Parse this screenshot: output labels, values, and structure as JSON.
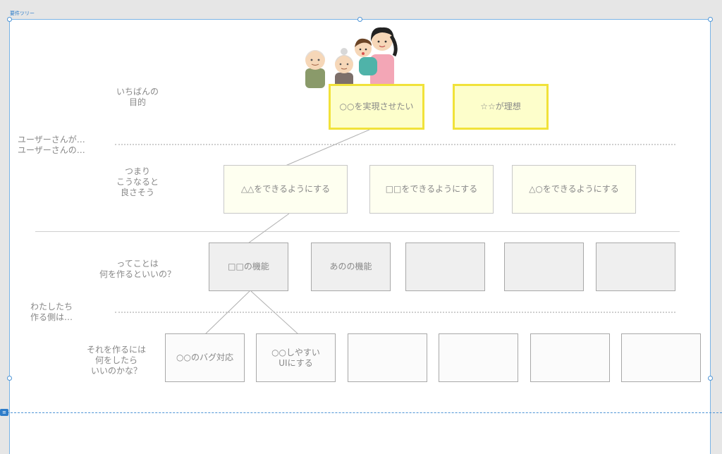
{
  "app": {
    "frame_title": "要件ツリー"
  },
  "rows": {
    "purpose": {
      "label": "いちばんの\n目的"
    },
    "user_side": {
      "label": "ユーザーさんが…\nユーザーさんの…"
    },
    "wish": {
      "label": "つまり\nこうなると\n良さそう"
    },
    "what": {
      "label": "ってことは\n何を作るといいの？"
    },
    "maker_side": {
      "label": "わたしたち\n作る側は…"
    },
    "how": {
      "label": "それを作るには\n何をしたら\nいいのかな？"
    }
  },
  "goals": [
    "○○を実現させたい",
    "☆☆が理想"
  ],
  "wishes": [
    "△△をできるようにする",
    "□□をできるようにする",
    "△○をできるようにする"
  ],
  "features": [
    "□□の機能",
    "あのの機能",
    "",
    "",
    ""
  ],
  "tasks": [
    "○○のバグ対応",
    "○○しやすい\nUIにする",
    "",
    "",
    "",
    ""
  ],
  "colors": {
    "goal_border": "#f1e23a",
    "goal_fill": "#fdfecb",
    "guide": "#4d94d6"
  },
  "illustration": "family-illustration"
}
